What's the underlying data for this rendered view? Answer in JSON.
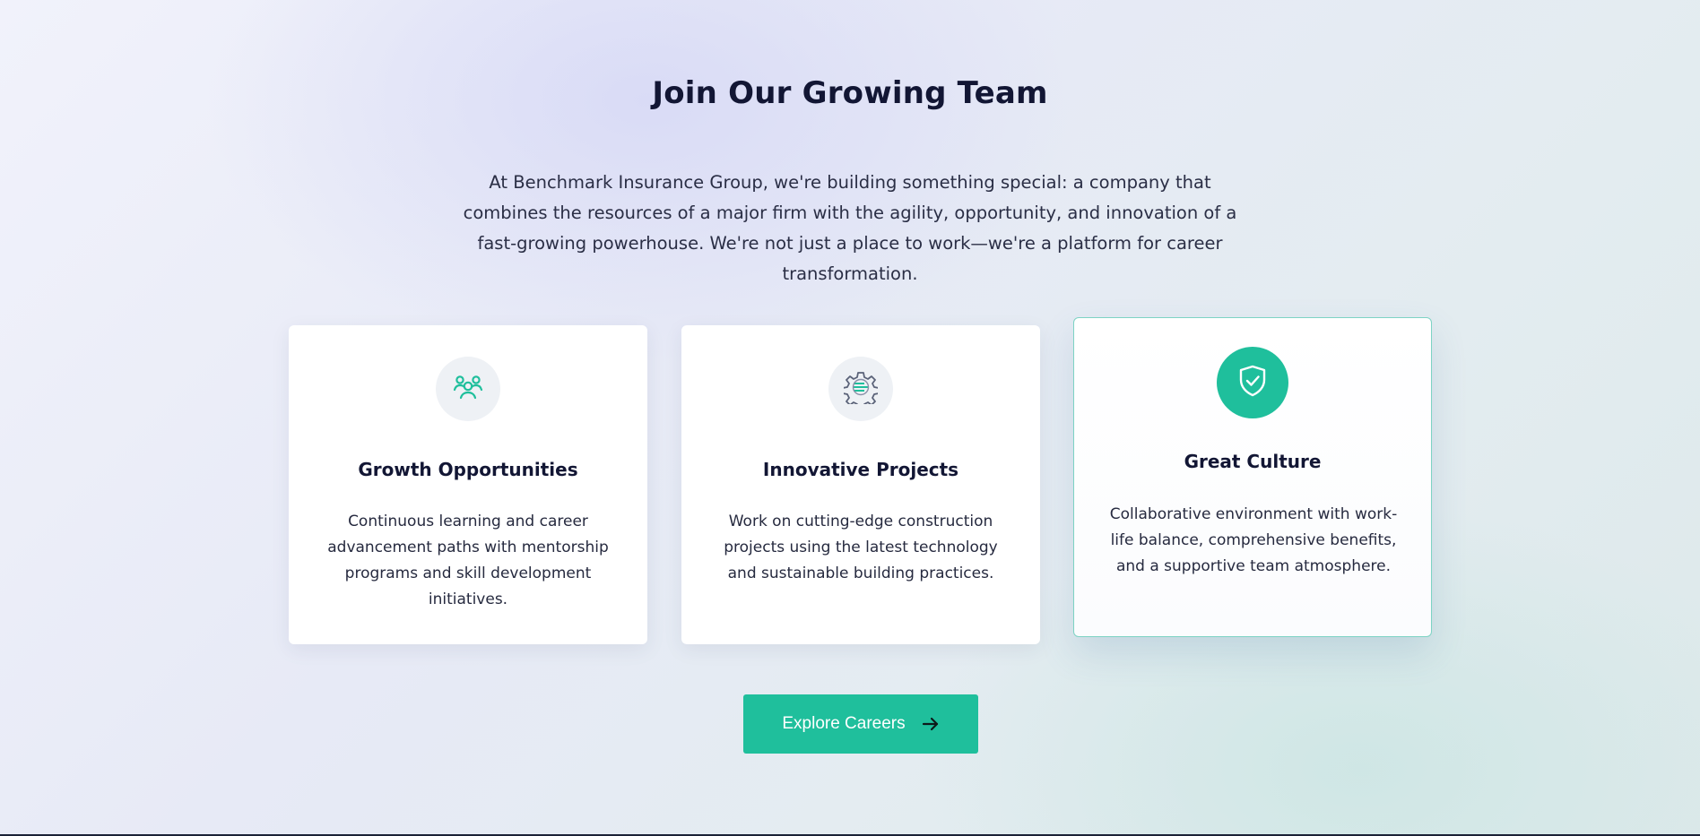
{
  "section": {
    "title": "Join Our Growing Team",
    "intro": "At Benchmark Insurance Group, we're building something special: a company that combines the resources of a major firm with the agility, opportunity, and innovation of a fast-growing powerhouse. We're not just a place to work—we're a platform for career transformation."
  },
  "cards": [
    {
      "icon": "team-icon",
      "title": "Growth Opportunities",
      "text": "Continuous learning and career advancement paths with mentorship programs and skill development initiatives."
    },
    {
      "icon": "gear-icon",
      "title": "Innovative Projects",
      "text": "Work on cutting-edge construction projects using the latest technology and sustainable building practices."
    },
    {
      "icon": "shield-check-icon",
      "title": "Great Culture",
      "text": "Collaborative environment with work-life balance, comprehensive benefits, and a supportive team atmosphere.",
      "highlighted": true
    }
  ],
  "cta": {
    "label": "Explore Careers",
    "icon": "arrow-right-icon"
  },
  "colors": {
    "accent": "#1fbf9c",
    "heading": "#121634",
    "body_text": "#262a3f",
    "highlight_border": "#7dd3c4"
  }
}
